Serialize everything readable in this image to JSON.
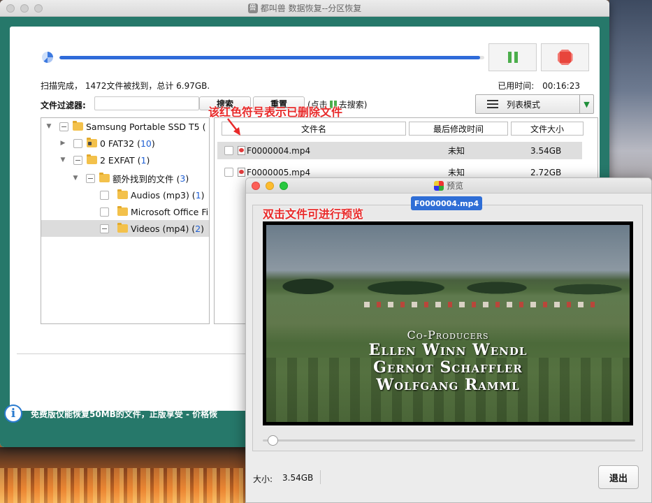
{
  "main_window": {
    "title": "都叫兽 数据恢复--分区恢复",
    "progress_fraction": 0.99,
    "scan_status": "扫描完成， 1472文件被找到，总计 6.97GB.",
    "elapsed_label": "已用时间:",
    "elapsed_value": "00:16:23",
    "filter_label": "文件过滤器:",
    "filter_value": "",
    "search_button": "搜索",
    "reset_button": "重置",
    "hint_prefix": "(点击",
    "hint_suffix": "去搜索)",
    "view_mode": "列表模式",
    "bottom_notice": "免费版仅能恢复50MB的文件，正版享受 - 价格恢"
  },
  "tree": [
    {
      "label": "Samsung Portable SSD T5 (",
      "count": "",
      "expand": "▼",
      "state": "partial"
    },
    {
      "label": "0 FAT32 (",
      "count": "10",
      "suffix": ")",
      "expand": "▶",
      "state": "empty"
    },
    {
      "label": "2 EXFAT (",
      "count": "1",
      "suffix": ")",
      "expand": "▼",
      "state": "partial"
    },
    {
      "label": "额外找到的文件 (",
      "count": "3",
      "suffix": ")",
      "expand": "▼",
      "state": "partial"
    },
    {
      "label": "Audios (mp3) (",
      "count": "1",
      "suffix": ")",
      "expand": "",
      "state": "empty"
    },
    {
      "label": "Microsoft Office Fil",
      "count": "",
      "suffix": "",
      "expand": "",
      "state": "empty"
    },
    {
      "label": "Videos (mp4) (",
      "count": "2",
      "suffix": ")",
      "expand": "",
      "state": "partial"
    }
  ],
  "file_list": {
    "columns": [
      "文件名",
      "最后修改时间",
      "文件大小"
    ],
    "rows": [
      {
        "name": "F0000004.mp4",
        "date": "未知",
        "size": "3.54GB"
      },
      {
        "name": "F0000005.mp4",
        "date": "未知",
        "size": "2.72GB"
      }
    ]
  },
  "annotations": {
    "deleted_marker": "该红色符号表示已删除文件",
    "preview_hint": "双击文件可进行预览"
  },
  "preview": {
    "title": "预览",
    "tab": "F0000004.mp4",
    "credits": [
      "Co-Producers",
      "Ellen Winn Wendl",
      "Gernot Schaffler",
      "Wolfgang Ramml"
    ],
    "size_label": "大小:",
    "size_value": "3.54GB",
    "exit_button": "退出",
    "playback_fraction": 0.02
  }
}
